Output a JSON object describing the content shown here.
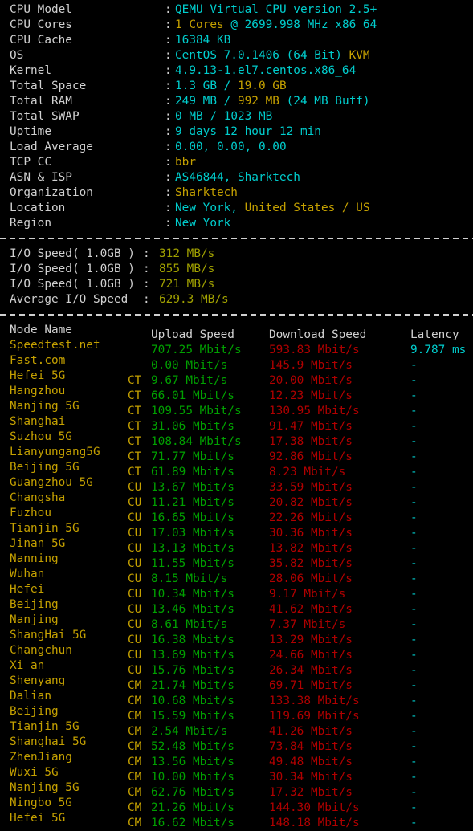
{
  "terminal": {
    "background": "#000000",
    "colors": {
      "label": "#d0d0d0",
      "cyan": "#00cdcd",
      "yellow": "#c4a000",
      "green": "#00a000",
      "red": "#b00000",
      "olive": "#a0a000"
    }
  },
  "system_info": {
    "rows": [
      {
        "label": "CPU Model",
        "colon": ":",
        "parts": [
          {
            "text": "QEMU Virtual CPU version 2.5+",
            "color": "cyan"
          }
        ]
      },
      {
        "label": "CPU Cores",
        "colon": ":",
        "parts": [
          {
            "text": "1 Cores",
            "color": "yellow"
          },
          {
            "text": " @ 2699.998 MHz x86_64",
            "color": "cyan"
          }
        ]
      },
      {
        "label": "CPU Cache",
        "colon": ":",
        "parts": [
          {
            "text": "16384 KB",
            "color": "cyan"
          }
        ]
      },
      {
        "label": "OS",
        "colon": ":",
        "parts": [
          {
            "text": "CentOS 7.0.1406 (64 Bit) ",
            "color": "cyan"
          },
          {
            "text": "KVM",
            "color": "yellow"
          }
        ]
      },
      {
        "label": "Kernel",
        "colon": ":",
        "parts": [
          {
            "text": "4.9.13-1.el7.centos.x86_64",
            "color": "cyan"
          }
        ]
      },
      {
        "label": "Total Space",
        "colon": ":",
        "parts": [
          {
            "text": "1.3 GB ",
            "color": "cyan"
          },
          {
            "text": "/ ",
            "color": "cyan"
          },
          {
            "text": "19.0 GB",
            "color": "yellow"
          }
        ]
      },
      {
        "label": "Total RAM",
        "colon": ":",
        "parts": [
          {
            "text": "249 MB ",
            "color": "cyan"
          },
          {
            "text": "/ ",
            "color": "cyan"
          },
          {
            "text": "992 MB",
            "color": "yellow"
          },
          {
            "text": " (24 MB Buff)",
            "color": "cyan"
          }
        ]
      },
      {
        "label": "Total SWAP",
        "colon": ":",
        "parts": [
          {
            "text": "0 MB ",
            "color": "cyan"
          },
          {
            "text": "/ ",
            "color": "cyan"
          },
          {
            "text": "1023 MB",
            "color": "cyan"
          }
        ]
      },
      {
        "label": "Uptime",
        "colon": ":",
        "parts": [
          {
            "text": "9 days 12 hour 12 min",
            "color": "cyan"
          }
        ]
      },
      {
        "label": "Load Average",
        "colon": ":",
        "parts": [
          {
            "text": "0.00, 0.00, 0.00",
            "color": "cyan"
          }
        ]
      },
      {
        "label": "TCP CC",
        "colon": ":",
        "parts": [
          {
            "text": "bbr",
            "color": "yellow"
          }
        ]
      },
      {
        "label": "ASN & ISP",
        "colon": ":",
        "parts": [
          {
            "text": "AS46844, Sharktech",
            "color": "cyan"
          }
        ]
      },
      {
        "label": "Organization",
        "colon": ":",
        "parts": [
          {
            "text": "Sharktech",
            "color": "yellow"
          }
        ]
      },
      {
        "label": "Location",
        "colon": ":",
        "parts": [
          {
            "text": "New York, ",
            "color": "cyan"
          },
          {
            "text": "United States / US",
            "color": "yellow"
          }
        ]
      },
      {
        "label": "Region",
        "colon": ":",
        "parts": [
          {
            "text": "New York",
            "color": "cyan"
          }
        ]
      }
    ]
  },
  "io_test": {
    "rows": [
      {
        "label": "I/O Speed( 1.0GB )",
        "colon": ":",
        "value": "312 MB/s"
      },
      {
        "label": "I/O Speed( 1.0GB )",
        "colon": ":",
        "value": "855 MB/s"
      },
      {
        "label": "I/O Speed( 1.0GB )",
        "colon": ":",
        "value": "721 MB/s"
      },
      {
        "label": "Average I/O Speed",
        "colon": ":",
        "value": "629.3 MB/s"
      }
    ]
  },
  "speedtest": {
    "headers": {
      "node": "Node Name",
      "isp": "",
      "upload": "Upload Speed",
      "download": "Download Speed",
      "latency": "Latency"
    },
    "rows": [
      {
        "node": "Speedtest.net",
        "isp": "",
        "upload": "707.25 Mbit/s",
        "download": "593.83 Mbit/s",
        "latency": "9.787 ms"
      },
      {
        "node": "Fast.com",
        "isp": "",
        "upload": "0.00 Mbit/s",
        "download": "145.9 Mbit/s",
        "latency": "-"
      },
      {
        "node": "Hefei 5G",
        "isp": "CT",
        "upload": "9.67 Mbit/s",
        "download": "20.00 Mbit/s",
        "latency": "-"
      },
      {
        "node": "Hangzhou",
        "isp": "CT",
        "upload": "66.01 Mbit/s",
        "download": "12.23 Mbit/s",
        "latency": "-"
      },
      {
        "node": "Nanjing 5G",
        "isp": "CT",
        "upload": "109.55 Mbit/s",
        "download": "130.95 Mbit/s",
        "latency": "-"
      },
      {
        "node": "Shanghai",
        "isp": "CT",
        "upload": "31.06 Mbit/s",
        "download": "91.47 Mbit/s",
        "latency": "-"
      },
      {
        "node": "Suzhou 5G",
        "isp": "CT",
        "upload": "108.84 Mbit/s",
        "download": "17.38 Mbit/s",
        "latency": "-"
      },
      {
        "node": "Lianyungang5G",
        "isp": "CT",
        "upload": "71.77 Mbit/s",
        "download": "92.86 Mbit/s",
        "latency": "-"
      },
      {
        "node": "Beijing 5G",
        "isp": "CT",
        "upload": "61.89 Mbit/s",
        "download": "8.23 Mbit/s",
        "latency": "-"
      },
      {
        "node": "Guangzhou 5G",
        "isp": "CU",
        "upload": "13.67 Mbit/s",
        "download": "33.59 Mbit/s",
        "latency": "-"
      },
      {
        "node": "Changsha",
        "isp": "CU",
        "upload": "11.21 Mbit/s",
        "download": "20.82 Mbit/s",
        "latency": "-"
      },
      {
        "node": "Fuzhou",
        "isp": "CU",
        "upload": "16.65 Mbit/s",
        "download": "22.26 Mbit/s",
        "latency": "-"
      },
      {
        "node": "Tianjin 5G",
        "isp": "CU",
        "upload": "17.03 Mbit/s",
        "download": "30.36 Mbit/s",
        "latency": "-"
      },
      {
        "node": "Jinan 5G",
        "isp": "CU",
        "upload": "13.13 Mbit/s",
        "download": "13.82 Mbit/s",
        "latency": "-"
      },
      {
        "node": "Nanning",
        "isp": "CU",
        "upload": "11.55 Mbit/s",
        "download": "35.82 Mbit/s",
        "latency": "-"
      },
      {
        "node": "Wuhan",
        "isp": "CU",
        "upload": "8.15 Mbit/s",
        "download": "28.06 Mbit/s",
        "latency": "-"
      },
      {
        "node": "Hefei",
        "isp": "CU",
        "upload": "10.34 Mbit/s",
        "download": "9.17 Mbit/s",
        "latency": "-"
      },
      {
        "node": "Beijing",
        "isp": "CU",
        "upload": "13.46 Mbit/s",
        "download": "41.62 Mbit/s",
        "latency": "-"
      },
      {
        "node": "Nanjing",
        "isp": "CU",
        "upload": "8.61 Mbit/s",
        "download": "7.37 Mbit/s",
        "latency": "-"
      },
      {
        "node": "ShangHai 5G",
        "isp": "CU",
        "upload": "16.38 Mbit/s",
        "download": "13.29 Mbit/s",
        "latency": "-"
      },
      {
        "node": "Changchun",
        "isp": "CU",
        "upload": "13.69 Mbit/s",
        "download": "24.66 Mbit/s",
        "latency": "-"
      },
      {
        "node": "Xi an",
        "isp": "CU",
        "upload": "15.76 Mbit/s",
        "download": "26.34 Mbit/s",
        "latency": "-"
      },
      {
        "node": "Shenyang",
        "isp": "CM",
        "upload": "21.74 Mbit/s",
        "download": "69.71 Mbit/s",
        "latency": "-"
      },
      {
        "node": "Dalian",
        "isp": "CM",
        "upload": "10.68 Mbit/s",
        "download": "133.38 Mbit/s",
        "latency": "-"
      },
      {
        "node": "Beijing",
        "isp": "CM",
        "upload": "15.59 Mbit/s",
        "download": "119.69 Mbit/s",
        "latency": "-"
      },
      {
        "node": "Tianjin 5G",
        "isp": "CM",
        "upload": "2.54 Mbit/s",
        "download": "41.26 Mbit/s",
        "latency": "-"
      },
      {
        "node": "Shanghai 5G",
        "isp": "CM",
        "upload": "52.48 Mbit/s",
        "download": "73.84 Mbit/s",
        "latency": "-"
      },
      {
        "node": "ZhenJiang",
        "isp": "CM",
        "upload": "13.56 Mbit/s",
        "download": "49.48 Mbit/s",
        "latency": "-"
      },
      {
        "node": "Wuxi 5G",
        "isp": "CM",
        "upload": "10.00 Mbit/s",
        "download": "30.34 Mbit/s",
        "latency": "-"
      },
      {
        "node": "Nanjing 5G",
        "isp": "CM",
        "upload": "62.76 Mbit/s",
        "download": "17.32 Mbit/s",
        "latency": "-"
      },
      {
        "node": "Ningbo 5G",
        "isp": "CM",
        "upload": "21.26 Mbit/s",
        "download": "144.30 Mbit/s",
        "latency": "-"
      },
      {
        "node": "Hefei 5G",
        "isp": "CM",
        "upload": "16.62 Mbit/s",
        "download": "148.18 Mbit/s",
        "latency": "-"
      }
    ]
  }
}
